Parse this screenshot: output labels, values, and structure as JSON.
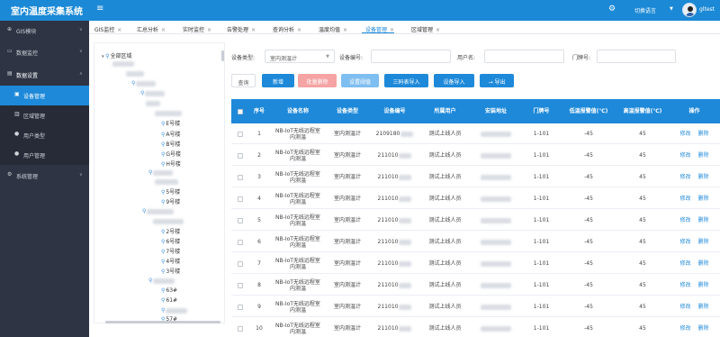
{
  "header": {
    "title": "室内温度采集系统",
    "menu_icon": "hamburger-icon",
    "settings_icon": "gear-icon",
    "language_label": "切换语言",
    "user_name": "gltest"
  },
  "sidebar": {
    "items": [
      {
        "icon": "globe-icon",
        "label": "GIS模块",
        "chevron": "chevron-down-icon"
      },
      {
        "icon": "monitor-icon",
        "label": "数据监控",
        "chevron": "chevron-down-icon"
      },
      {
        "icon": "database-icon",
        "label": "数据设置",
        "chevron": "chevron-up-icon"
      },
      {
        "icon": "device-icon",
        "label": "设备管理"
      },
      {
        "icon": "building-icon",
        "label": "区域管理"
      },
      {
        "icon": "user-icon",
        "label": "用户类型"
      },
      {
        "icon": "user-icon",
        "label": "用户管理"
      },
      {
        "icon": "gear-icon",
        "label": "系统管理",
        "chevron": "chevron-down-icon"
      }
    ]
  },
  "tabs": [
    "GIS监控",
    "汇总分析",
    "实时监控",
    "告警处理",
    "查询分析",
    "温度均值",
    "设备管理",
    "区域管理"
  ],
  "active_tab_index": 6,
  "tree": {
    "root": "全部区域",
    "leaves": [
      "E号楼",
      "A号楼",
      "B号楼",
      "G号楼",
      "H号楼",
      "5号楼",
      "9号楼",
      "2号楼",
      "6号楼",
      "7号楼",
      "4号楼",
      "3号楼",
      "63#",
      "61#",
      "57#"
    ]
  },
  "filters": {
    "device_type_label": "设备类型:",
    "device_type_value": "室内测温计",
    "device_no_label": "设备编号:",
    "device_no_value": "",
    "user_name_label": "用户名:",
    "user_name_value": "",
    "door_no_label": "门牌号:",
    "door_no_value": ""
  },
  "buttons": {
    "query": "查询",
    "add": "新增",
    "batch_delete": "批量删除",
    "set_threshold": "设置阈值",
    "import_tri": "三码表导入",
    "import_device": "设备导入",
    "export": "→ 导出"
  },
  "table": {
    "headers": [
      "序号",
      "设备名称",
      "设备类型",
      "设备编号",
      "所属用户",
      "安装地址",
      "门牌号",
      "低温报警值(℃)",
      "高温报警值(℃)",
      "操作"
    ],
    "rows": [
      {
        "no": "1",
        "name": "NB-IoT无线远程室内测温",
        "type": "室内测温计",
        "id": "2109180",
        "user": "测试上线人员",
        "door": "1-101",
        "low": "-45",
        "high": "45"
      },
      {
        "no": "2",
        "name": "NB-IoT无线远程室内测温",
        "type": "室内测温计",
        "id": "211010",
        "user": "测试上线人员",
        "door": "1-101",
        "low": "-45",
        "high": "45"
      },
      {
        "no": "3",
        "name": "NB-IoT无线远程室内测温",
        "type": "室内测温计",
        "id": "211010",
        "user": "测试上线人员",
        "door": "1-101",
        "low": "-45",
        "high": "45"
      },
      {
        "no": "4",
        "name": "NB-IoT无线远程室内测温",
        "type": "室内测温计",
        "id": "211010",
        "user": "测试上线人员",
        "door": "1-101",
        "low": "-45",
        "high": "45"
      },
      {
        "no": "5",
        "name": "NB-IoT无线远程室内测温",
        "type": "室内测温计",
        "id": "211010",
        "user": "测试上线人员",
        "door": "1-101",
        "low": "-45",
        "high": "45"
      },
      {
        "no": "6",
        "name": "NB-IoT无线远程室内测温",
        "type": "室内测温计",
        "id": "211010",
        "user": "测试上线人员",
        "door": "1-101",
        "low": "-45",
        "high": "45"
      },
      {
        "no": "7",
        "name": "NB-IoT无线远程室内测温",
        "type": "室内测温计",
        "id": "211010",
        "user": "测试上线人员",
        "door": "1-101",
        "low": "-45",
        "high": "45"
      },
      {
        "no": "8",
        "name": "NB-IoT无线远程室内测温",
        "type": "室内测温计",
        "id": "211010",
        "user": "测试上线人员",
        "door": "1-101",
        "low": "-45",
        "high": "45"
      },
      {
        "no": "9",
        "name": "NB-IoT无线远程室内测温",
        "type": "室内测温计",
        "id": "211010",
        "user": "测试上线人员",
        "door": "1-101",
        "low": "-45",
        "high": "45"
      },
      {
        "no": "10",
        "name": "NB-IoT无线远程室内测温",
        "type": "室内测温计",
        "id": "211010",
        "user": "测试上线人员",
        "door": "1-101",
        "low": "-45",
        "high": "45"
      }
    ],
    "edit_label": "修改",
    "delete_label": "删除"
  },
  "colors": {
    "primary": "#1e89d9",
    "topbar": "#1b89d6",
    "sidebar": "#2e3443",
    "danger_light": "#f5a3a3"
  }
}
